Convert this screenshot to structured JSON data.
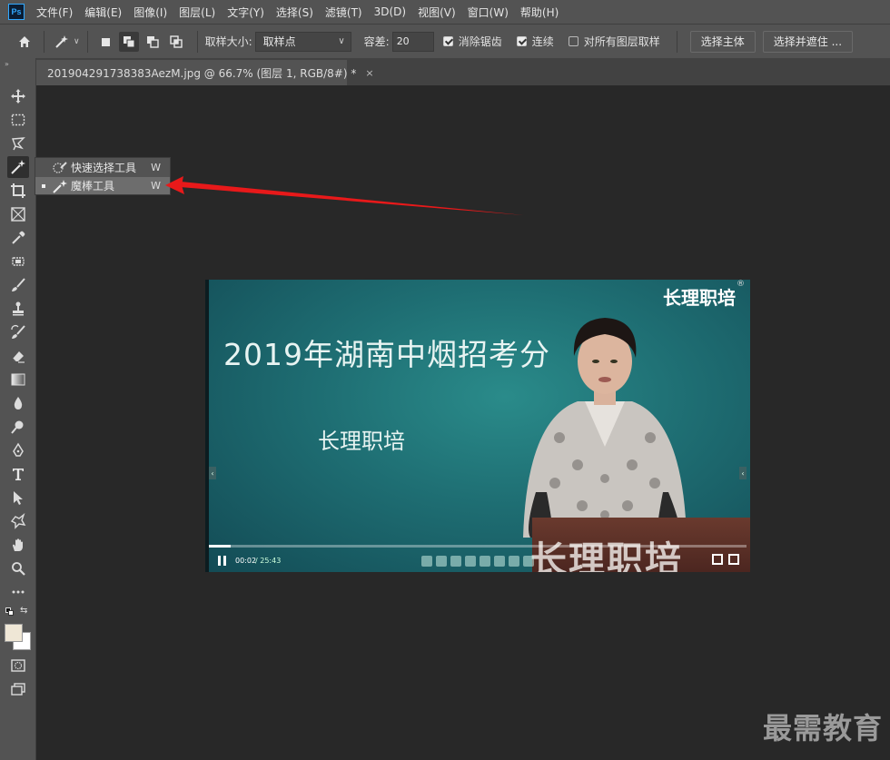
{
  "app": {
    "logo_text": "Ps",
    "menu": [
      "文件(F)",
      "编辑(E)",
      "图像(I)",
      "图层(L)",
      "文字(Y)",
      "选择(S)",
      "滤镜(T)",
      "3D(D)",
      "视图(V)",
      "窗口(W)",
      "帮助(H)"
    ]
  },
  "options": {
    "sample_size_label": "取样大小:",
    "sample_size_value": "取样点",
    "tolerance_label": "容差:",
    "tolerance_value": "20",
    "anti_alias_label": "消除锯齿",
    "contiguous_label": "连续",
    "sample_all_label": "对所有图层取样",
    "select_subject_label": "选择主体",
    "select_mask_label": "选择并遮住 ..."
  },
  "document": {
    "tab_title": "201904291738383AezM.jpg @ 66.7% (图层 1, RGB/8#) *",
    "close_glyph": "×"
  },
  "flyout": {
    "items": [
      {
        "label": "快速选择工具",
        "key": "W",
        "selected": false
      },
      {
        "label": "魔棒工具",
        "key": "W",
        "selected": true
      }
    ]
  },
  "video": {
    "title": "2019年湖南中烟招考分",
    "subtitle": "长理职培",
    "logo": "长理职培",
    "logo_mark": "®",
    "podium_text": "长理职培",
    "time_current": "00:02",
    "time_total": "/ 25:43",
    "progress_fraction": 0.04,
    "side_left": "‹",
    "side_right": "‹"
  },
  "watermark": "最需教育",
  "colors": {
    "accent_arrow": "#e8191a",
    "ps_blue": "#31a8ff"
  }
}
